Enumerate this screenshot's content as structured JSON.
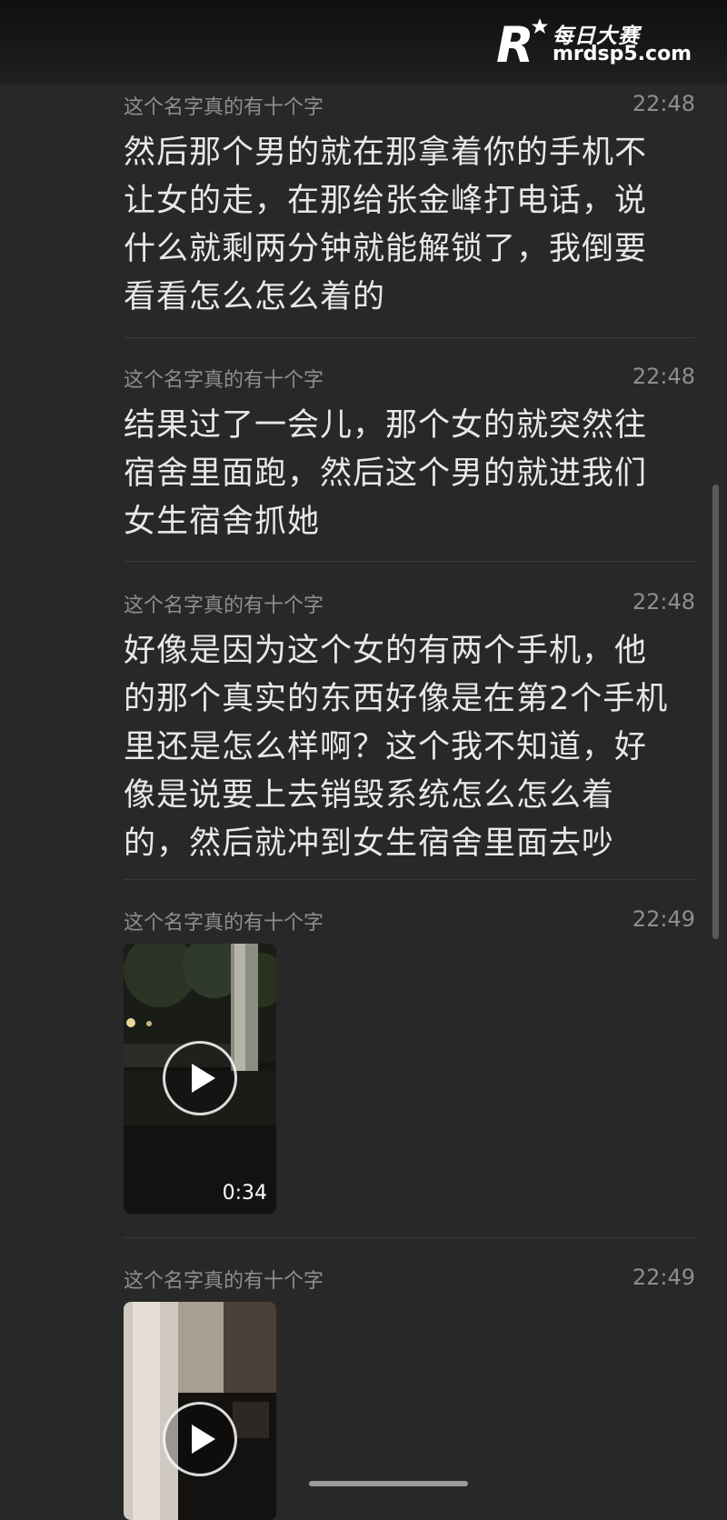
{
  "watermark": {
    "brand_cn": "每日大赛",
    "url": "mrdsp5.com",
    "logo_letter": "R"
  },
  "messages": [
    {
      "sender": "这个名字真的有十个字",
      "time": "22:48",
      "text": "然后那个男的就在那拿着你的手机不让女的走，在那给张金峰打电话，说什么就剩两分钟就能解锁了，我倒要看看怎么怎么着的"
    },
    {
      "sender": "这个名字真的有十个字",
      "time": "22:48",
      "text": "结果过了一会儿，那个女的就突然往宿舍里面跑，然后这个男的就进我们女生宿舍抓她"
    },
    {
      "sender": "这个名字真的有十个字",
      "time": "22:48",
      "text": "好像是因为这个女的有两个手机，他的那个真实的东西好像是在第2个手机里还是怎么样啊？这个我不知道，好像是说要上去销毁系统怎么怎么着的，然后就冲到女生宿舍里面去吵"
    },
    {
      "sender": "这个名字真的有十个字",
      "time": "22:49",
      "video_duration": "0:34"
    },
    {
      "sender": "这个名字真的有十个字",
      "time": "22:49"
    }
  ],
  "colors": {
    "background": "#282828",
    "meta_text": "#8e8e8e",
    "body_text": "#e8e8e8",
    "divider": "#3a3a3a"
  },
  "icons": {
    "play": "play-icon",
    "star": "star-icon"
  }
}
